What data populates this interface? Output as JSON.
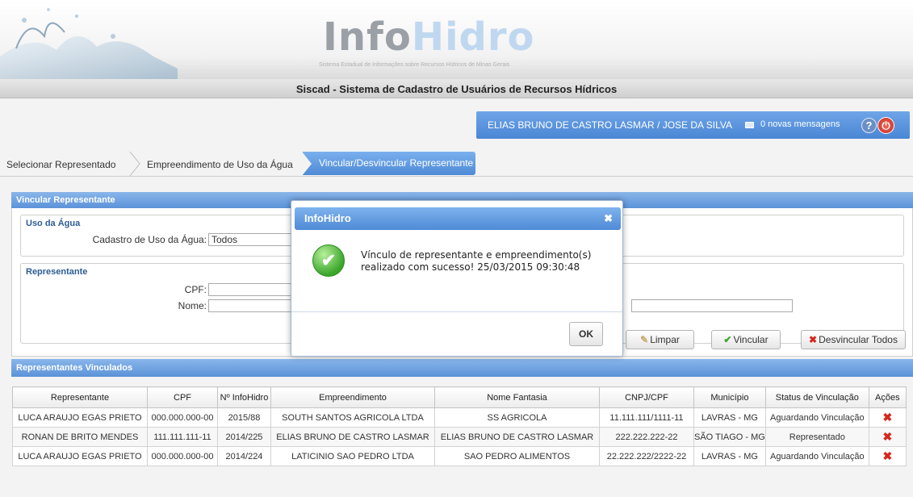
{
  "header": {
    "logo_part1": "Info",
    "logo_part2": "Hidro",
    "logo_subtitle": "Sistema Estadual de Informações sobre Recursos Hídricos de Minas Gerais",
    "page_title": "Siscad - Sistema de Cadastro de Usuários de Recursos Hídricos"
  },
  "userbar": {
    "user": "ELIAS BRUNO DE CASTRO LASMAR  /  JOSE DA SILVA",
    "messages": "0 novas mensagens",
    "help_icon": "?",
    "power_icon": "⏻"
  },
  "wizard": {
    "steps": [
      "Selecionar Representado",
      "Empreendimento de Uso da Água",
      "Vincular/Desvincular Representante"
    ],
    "active_color": "#4f8ad6"
  },
  "form": {
    "panel_title": "Vincular Representante",
    "uso": {
      "title": "Uso da Água",
      "cadastro_label": "Cadastro de Uso da Água:",
      "cadastro_value": "Todos"
    },
    "representante": {
      "title": "Representante",
      "cpf_label": "CPF:",
      "nome_label": "Nome:",
      "cpf_value": "",
      "nome_value": ""
    },
    "buttons": {
      "limpar": "Limpar",
      "vincular": "Vincular",
      "desvincular_todos": "Desvincular Todos"
    }
  },
  "table": {
    "title": "Representantes Vinculados",
    "headers": [
      "Representante",
      "CPF",
      "Nº InfoHidro",
      "Empreendimento",
      "Nome Fantasia",
      "CNPJ/CPF",
      "Município",
      "Status de Vinculação",
      "Ações"
    ],
    "rows": [
      [
        "LUCA ARAUJO EGAS PRIETO",
        "000.000.000-00",
        "2015/88",
        "SOUTH SANTOS AGRICOLA LTDA",
        "SS AGRICOLA",
        "11.111.111/1111-11",
        "LAVRAS - MG",
        "Aguardando Vinculação"
      ],
      [
        "RONAN DE BRITO MENDES",
        "111.111.111-11",
        "2014/225",
        "ELIAS BRUNO DE CASTRO LASMAR",
        "ELIAS BRUNO DE CASTRO LASMAR",
        "222.222.222-22",
        "SÃO TIAGO - MG",
        "Representado"
      ],
      [
        "LUCA ARAUJO EGAS PRIETO",
        "000.000.000-00",
        "2014/224",
        "LATICINIO SAO PEDRO LTDA",
        "SAO PEDRO ALIMENTOS",
        "22.222.222/2222-22",
        "LAVRAS - MG",
        "Aguardando Vinculação"
      ]
    ],
    "action_icon": "delete-icon"
  },
  "modal": {
    "title": "InfoHidro",
    "message": "Vínculo de representante e empreendimento(s) realizado com sucesso! 25/03/2015 09:30:48",
    "ok": "OK"
  }
}
